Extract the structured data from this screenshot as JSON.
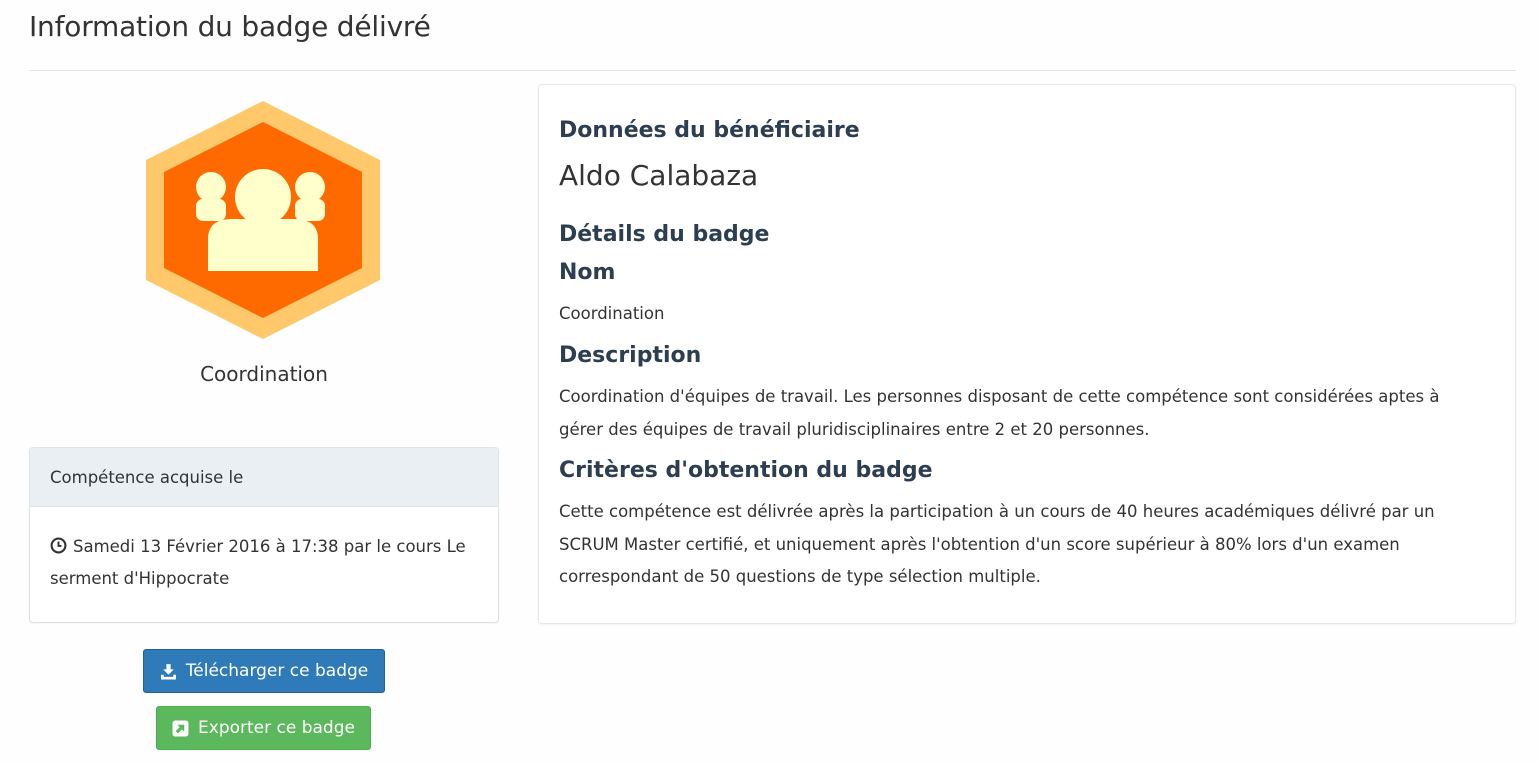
{
  "page": {
    "title": "Information du badge délivré"
  },
  "badge": {
    "icon": "people-group-icon",
    "colors": {
      "outer_ring": "#ffc86b",
      "inner_fill": "#ff6a00",
      "figure": "#ffffcc"
    },
    "caption": "Coordination"
  },
  "acquired": {
    "heading": "Compétence acquise le",
    "icon": "clock-icon",
    "text": "Samedi 13 Février 2016 à 17:38 par le cours Le serment d'Hippocrate"
  },
  "actions": {
    "download_label": "Télécharger ce badge",
    "download_icon": "download-icon",
    "download_color": "#2f7ab9",
    "export_label": "Exporter ce badge",
    "export_icon": "external-link-icon",
    "export_color": "#5cb85c"
  },
  "details": {
    "beneficiary_heading": "Données du bénéficiaire",
    "beneficiary_name": "Aldo Calabaza",
    "badge_details_heading": "Détails du badge",
    "name_heading": "Nom",
    "name_value": "Coordination",
    "description_heading": "Description",
    "description_text": "Coordination d'équipes de travail. Les personnes disposant de cette compétence sont considérées aptes à gérer des équipes de travail pluridisciplinaires entre 2 et 20 personnes.",
    "criteria_heading": "Critères d'obtention du badge",
    "criteria_text": "Cette compétence est délivrée après la participation à un cours de 40 heures académiques délivré par un SCRUM Master certifié, et uniquement après l'obtention d'un score supérieur à 80% lors d'un examen correspondant de 50 questions de type sélection multiple."
  }
}
